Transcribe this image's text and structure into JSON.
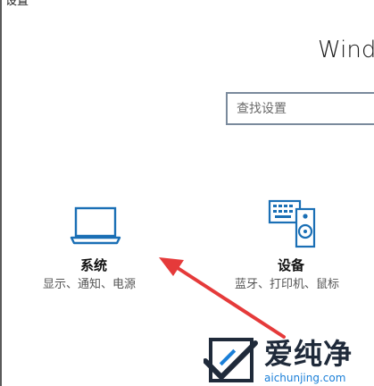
{
  "window": {
    "title": "设置"
  },
  "heading": "Windo",
  "search": {
    "placeholder": "查找设置"
  },
  "tiles": [
    {
      "icon": "laptop-icon",
      "title": "系统",
      "subtitle": "显示、通知、电源"
    },
    {
      "icon": "keyboard-speaker-icon",
      "title": "设备",
      "subtitle": "蓝牙、打印机、鼠标"
    }
  ],
  "watermark": {
    "name": "爱纯净",
    "url": "aichunjing.com"
  },
  "colors": {
    "accent": "#1a6fb5",
    "arrow": "#e53a3a",
    "search_border": "#7a8a9c"
  }
}
